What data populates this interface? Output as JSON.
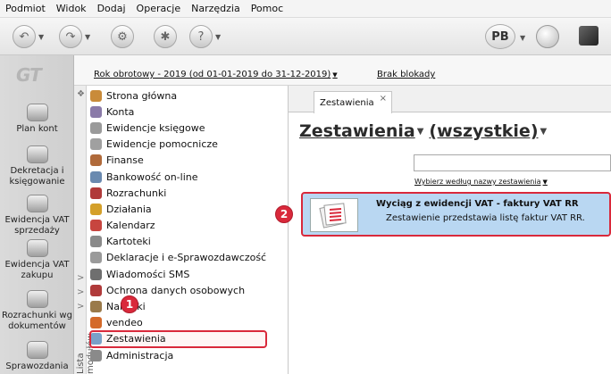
{
  "menubar": [
    "Podmiot",
    "Widok",
    "Dodaj",
    "Operacje",
    "Narzędzia",
    "Pomoc"
  ],
  "toolbar": {
    "profile_badge": "PB"
  },
  "leftbar": {
    "logo": "GT",
    "items": [
      {
        "label": "Plan kont"
      },
      {
        "label": "Dekretacja i księgowanie"
      },
      {
        "label": "Ewidencja VAT sprzedaży"
      },
      {
        "label": "Ewidencja VAT zakupu"
      },
      {
        "label": "Rozrachunki wg dokumentów"
      },
      {
        "label": "Sprawozdania"
      }
    ]
  },
  "inforow": {
    "fiscal_year": "Rok obrotowy - 2019  (od 01-01-2019 do 31-12-2019)",
    "locks": "Brak blokady"
  },
  "modules": {
    "side_tab_label": "Lista modułów",
    "items": [
      {
        "label": "Strona główna",
        "color": "#c98b3a"
      },
      {
        "label": "Konta",
        "color": "#8a7aa8"
      },
      {
        "label": "Ewidencje księgowe",
        "color": "#9a9a9a"
      },
      {
        "label": "Ewidencje pomocnicze",
        "color": "#a0a0a0"
      },
      {
        "label": "Finanse",
        "color": "#b06a3a"
      },
      {
        "label": "Bankowość on-line",
        "color": "#6a8ab0"
      },
      {
        "label": "Rozrachunki",
        "color": "#b03a3a"
      },
      {
        "label": "Działania",
        "color": "#d4a02a"
      },
      {
        "label": "Kalendarz",
        "color": "#c7453f"
      },
      {
        "label": "Kartoteki",
        "color": "#8a8a8a"
      },
      {
        "label": "Deklaracje i e-Sprawozdawczość",
        "color": "#9a9a9a"
      },
      {
        "label": "Wiadomości SMS",
        "color": "#6f6f6f"
      },
      {
        "label": "Ochrona danych osobowych",
        "color": "#b03a3a"
      },
      {
        "label": "Naklejki",
        "color": "#9a7a4a"
      },
      {
        "label": "vendeo",
        "color": "#d46a2a"
      },
      {
        "label": "Zestawienia",
        "color": "#7aa0c8"
      },
      {
        "label": "Administracja",
        "color": "#8a8a8a"
      }
    ],
    "active_index": 15
  },
  "badges": {
    "step1": "1",
    "step2": "2"
  },
  "content": {
    "tab_label": "Zestawienia",
    "tab_close": "×",
    "heading_main": "Zestawienia",
    "heading_filter": "(wszystkie)",
    "search_value": "",
    "search_hint": "Wybierz według nazwy zestawienia",
    "result": {
      "title": "Wyciąg z ewidencji VAT - faktury VAT RR",
      "description": "Zestawienie przedstawia listę faktur VAT RR."
    }
  },
  "colors": {
    "accent_red": "#d9293b",
    "selection_blue": "#b9d7f2"
  }
}
